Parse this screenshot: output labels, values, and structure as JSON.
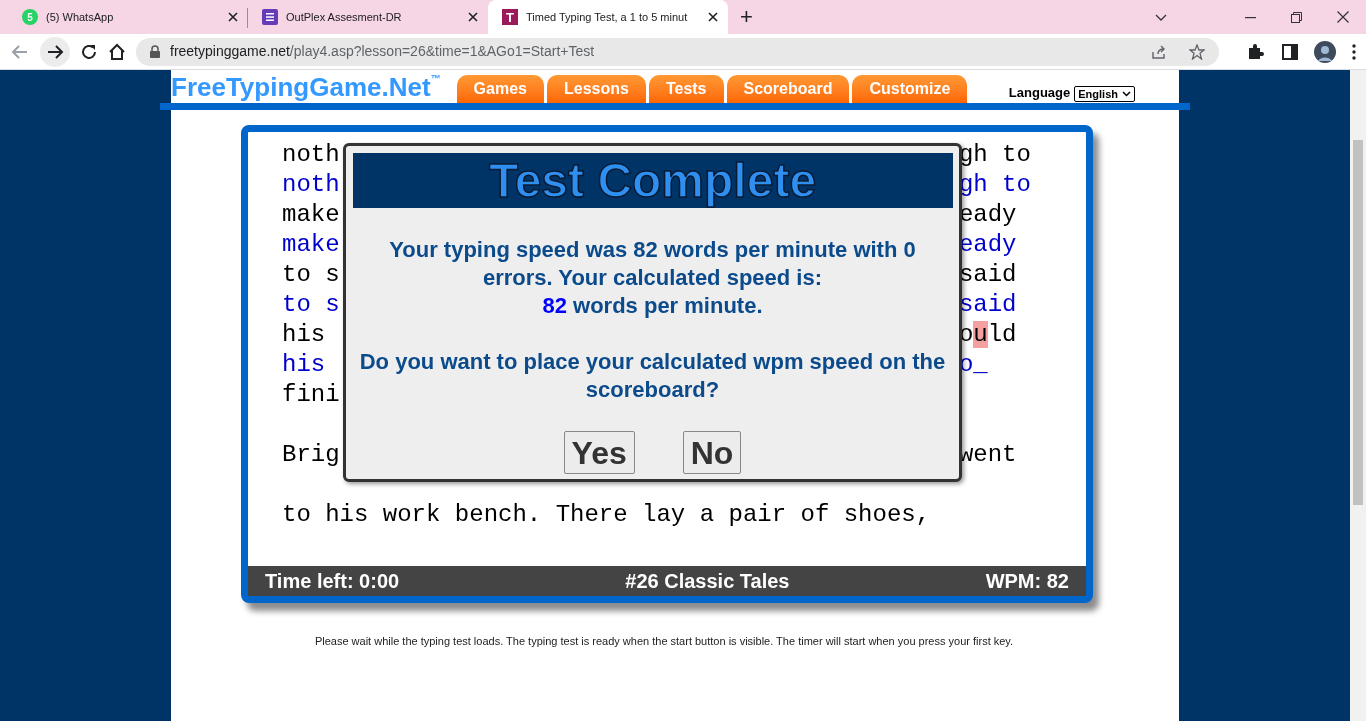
{
  "browser": {
    "tabs": [
      {
        "title": "(5) WhatsApp",
        "selected": false
      },
      {
        "title": "OutPlex Assesment-DR",
        "selected": false
      },
      {
        "title": "Timed Typing Test, a 1 to 5 minut",
        "selected": true
      }
    ],
    "tab_icon_letters": [
      "5",
      "T"
    ],
    "new_tab": "+",
    "url_host": "freetypinggame.net",
    "url_path": "/play4.asp?lesson=26&time=1&AGo1=Start+Test"
  },
  "site": {
    "logo": "FreeTypingGame.Net",
    "logo_mark": "™",
    "nav": [
      "Games",
      "Lessons",
      "Tests",
      "Scoreboard",
      "Customize"
    ],
    "language_label": "Language",
    "language_value": "English"
  },
  "typing_lines": [
    {
      "kind": "source",
      "left": "noth",
      "right": [
        {
          "text": "gh to",
          "current": false
        }
      ]
    },
    {
      "kind": "typed",
      "left": "noth",
      "right": [
        {
          "text": "gh to",
          "current": false
        }
      ]
    },
    {
      "kind": "source",
      "left": "make",
      "right": [
        {
          "text": "eady",
          "current": false
        }
      ]
    },
    {
      "kind": "typed",
      "left": "make",
      "right": [
        {
          "text": "eady",
          "current": false
        }
      ]
    },
    {
      "kind": "source",
      "left": "to s",
      "right": [
        {
          "text": "said",
          "current": false
        }
      ]
    },
    {
      "kind": "typed",
      "left": "to s",
      "right": [
        {
          "text": "said",
          "current": false
        }
      ]
    },
    {
      "kind": "source",
      "left": "his",
      "right": [
        {
          "text": "o",
          "current": false
        },
        {
          "text": "u",
          "current": true
        },
        {
          "text": "ld",
          "current": false
        }
      ]
    },
    {
      "kind": "typed",
      "left": "his",
      "right": [
        {
          "text": "o_",
          "current": false
        }
      ]
    },
    {
      "kind": "source",
      "left": "fini"
    },
    {
      "kind": "blank"
    },
    {
      "kind": "source",
      "left": "Brig",
      "right": [
        {
          "text": "went",
          "current": false
        }
      ]
    },
    {
      "kind": "blank"
    },
    {
      "kind": "source",
      "left": "to his work bench. There lay a pair of shoes,"
    }
  ],
  "status": {
    "time_left": "Time left: 0:00",
    "lesson": "#26 Classic Tales",
    "wpm": "WPM: 82"
  },
  "dialog": {
    "title": "Test Complete",
    "message": "Your typing speed was 82 words per minute with 0 errors. Your calculated speed is:",
    "speed": "82",
    "speed_suffix": " words per minute.",
    "question": "Do you want to place your calculated wpm speed on the scoreboard?",
    "buttons": [
      "Yes",
      "No"
    ]
  },
  "footer_note": "Please wait while the typing test loads. The typing test is ready when the start button is visible. The timer will start when you press your first key."
}
